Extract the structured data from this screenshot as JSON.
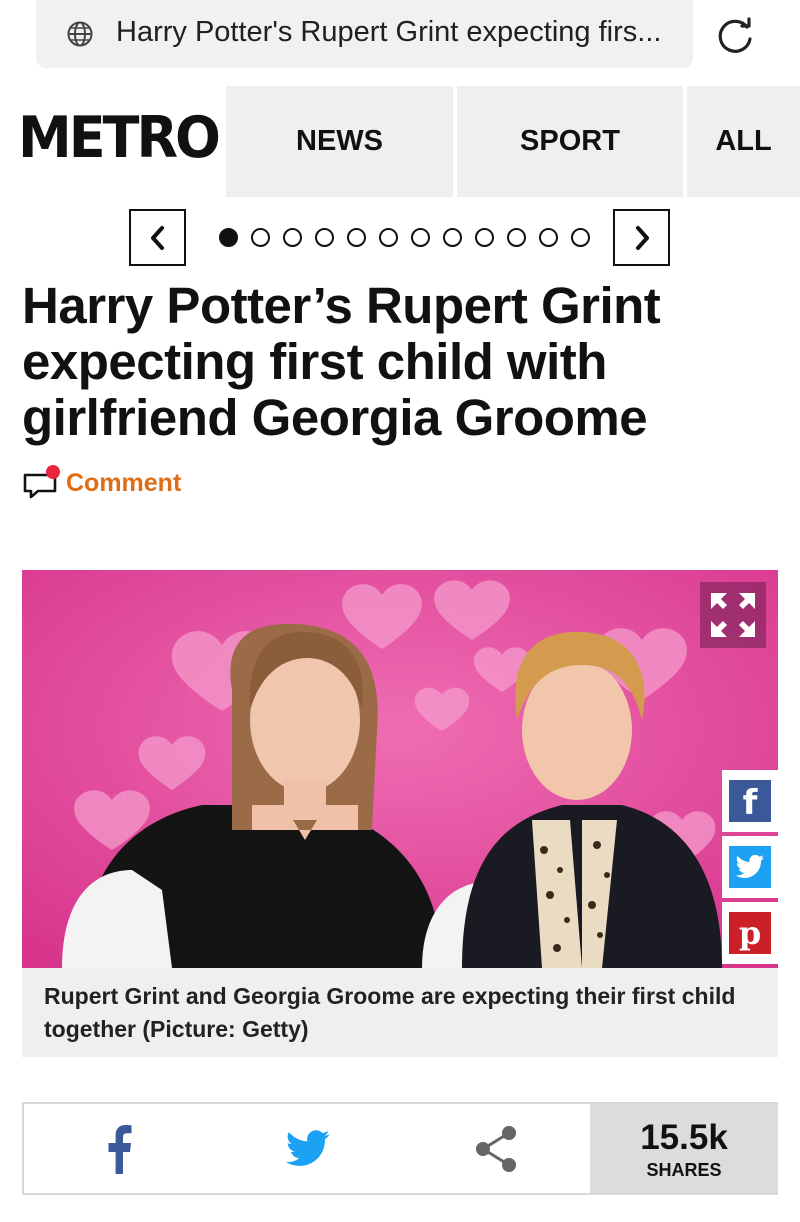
{
  "address_bar": {
    "url_title": "Harry Potter's Rupert Grint expecting firs..."
  },
  "header": {
    "logo": "METRO",
    "nav": [
      "NEWS",
      "SPORT",
      "ALL"
    ]
  },
  "carousel": {
    "current": 1,
    "total": 12
  },
  "article": {
    "headline": "Harry Potter’s Rupert Grint expecting first child with girlfriend Georgia Groome",
    "comment_label": "Comment",
    "caption": "Rupert Grint and Georgia Groome are expecting their first child together (Picture: Getty)"
  },
  "share_bar": {
    "count": "15.5k",
    "label": "SHARES"
  },
  "colors": {
    "comment_accent": "#e06d13",
    "facebook": "#3b5998",
    "twitter": "#1da1f2",
    "pinterest": "#cb2027",
    "photo_background": "#e14a9b"
  },
  "icons": [
    "globe-icon",
    "reload-icon",
    "chevron-left-icon",
    "chevron-right-icon",
    "comment-icon",
    "expand-icon",
    "facebook-icon",
    "twitter-icon",
    "pinterest-icon",
    "share-icon"
  ]
}
